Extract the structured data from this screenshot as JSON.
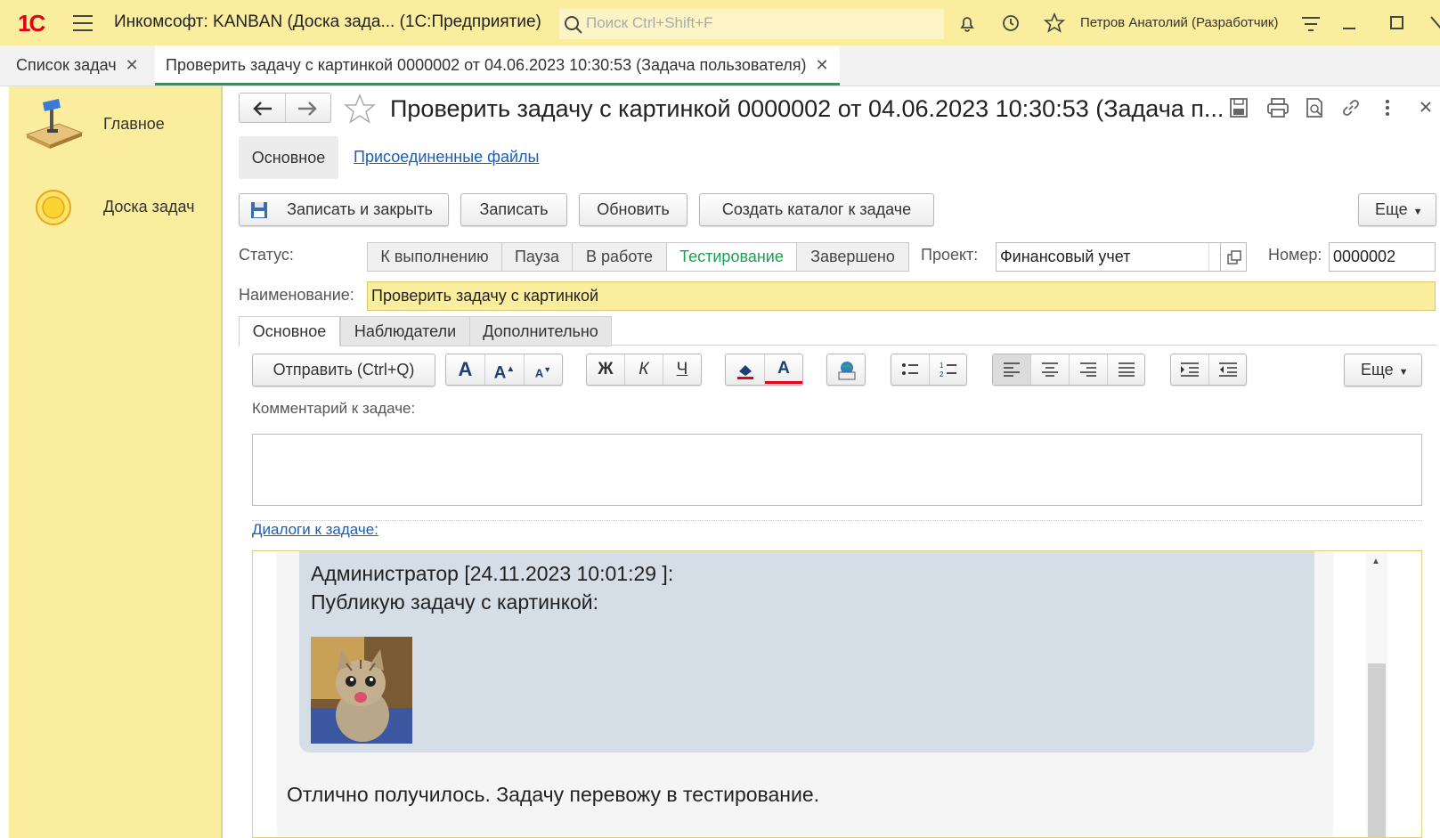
{
  "app": {
    "logo": "1С",
    "title": "Инкомсофт: KANBAN (Доска зада...  (1С:Предприятие)",
    "search_placeholder": "Поиск Ctrl+Shift+F",
    "user": "Петров Анатолий (Разработчик)"
  },
  "open_tabs": [
    {
      "label": "Список задач"
    },
    {
      "label": "Проверить задачу с картинкой 0000002 от 04.06.2023 10:30:53 (Задача пользователя)"
    }
  ],
  "sidebar": {
    "items": [
      {
        "label": "Главное",
        "icon": "desk-lamp-icon"
      },
      {
        "label": "Доска задач",
        "icon": "sun-circle-icon"
      }
    ]
  },
  "form": {
    "title": "Проверить задачу с картинкой 0000002 от 04.06.2023 10:30:53 (Задача п...",
    "nav_tabs": [
      {
        "label": "Основное"
      },
      {
        "label": "Присоединенные файлы"
      }
    ],
    "buttons": {
      "save_close": "Записать и закрыть",
      "save": "Записать",
      "refresh": "Обновить",
      "create_catalog": "Создать каталог к задаче",
      "more": "Еще"
    },
    "status_label": "Статус:",
    "statuses": [
      "К выполнению",
      "Пауза",
      "В работе",
      "Тестирование",
      "Завершено"
    ],
    "active_status": "Тестирование",
    "project_label": "Проект:",
    "project_value": "Финансовый учет",
    "number_label": "Номер:",
    "number_value": "0000002",
    "name_label": "Наименование:",
    "name_value": "Проверить задачу с картинкой",
    "sub_tabs": [
      "Основное",
      "Наблюдатели",
      "Дополнительно"
    ],
    "send_button": "Отправить (Ctrl+Q)",
    "format": {
      "bold": "Ж",
      "italic": "К",
      "underline": "Ч",
      "font_large": "A",
      "font_increase": "A",
      "font_decrease": "A",
      "font_color": "A"
    },
    "more2": "Еще",
    "comment_label": "Комментарий к задаче:",
    "dialogs_link": "Диалоги к задаче:",
    "messages": [
      {
        "header": "Администратор [24.11.2023 10:01:29 ]:",
        "text": "Публикую задачу с картинкой:"
      },
      {
        "text": "Отлично получилось. Задачу перевожу в тестирование."
      }
    ]
  },
  "colors": {
    "topbar": "#fbed9e",
    "accent_green": "#1e9e52",
    "link": "#1a5fb4",
    "message_bg": "#d5dde6",
    "name_field": "#fbed9e"
  }
}
